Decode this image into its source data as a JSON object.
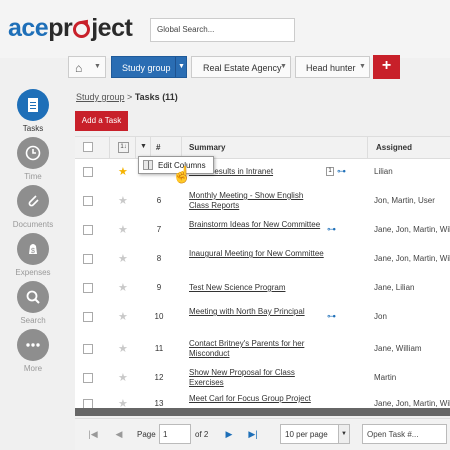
{
  "logo": {
    "part1": "ace",
    "part2": "pr",
    "part3": "ject"
  },
  "search": {
    "placeholder": "Global Search..."
  },
  "toolbar": {
    "home_icon": "home-icon",
    "study_group": "Study group",
    "real_estate": "Real Estate Agency",
    "head_hunter": "Head hunter",
    "add_symbol": "+"
  },
  "sidebar": {
    "items": [
      {
        "label": "Tasks",
        "icon": "tasks-icon",
        "active": true
      },
      {
        "label": "Time",
        "icon": "time-icon"
      },
      {
        "label": "Documents",
        "icon": "documents-icon"
      },
      {
        "label": "Expenses",
        "icon": "expenses-icon"
      },
      {
        "label": "Search",
        "icon": "search-icon"
      },
      {
        "label": "More",
        "icon": "more-icon"
      }
    ]
  },
  "breadcrumb": {
    "project": "Study group",
    "sep": " > ",
    "current": "Tasks",
    "count": "(11)"
  },
  "add_task": "Add a Task",
  "table": {
    "headers": {
      "sort": "1↓",
      "num": "#",
      "summary": "Summary",
      "assigned": "Assigned"
    },
    "rows": [
      {
        "star": true,
        "num": "",
        "summary": "...nal Results in Intranet",
        "assigned": "Lilian",
        "priority": "1",
        "link": true
      },
      {
        "star": false,
        "num": "6",
        "summary": "Monthly Meeting - Show English Class Reports",
        "assigned": "Jon, Martin, User"
      },
      {
        "star": false,
        "num": "7",
        "summary": "Brainstorm Ideas for New Committee",
        "assigned": "Jane, Jon, Martin, Will",
        "link": true
      },
      {
        "star": false,
        "num": "8",
        "summary": "Inaugural Meeting for New Committee",
        "assigned": "Jane, Jon, Martin, Will"
      },
      {
        "star": false,
        "num": "9",
        "summary": "Test New Science Program",
        "assigned": "Jane, Lilian"
      },
      {
        "star": false,
        "num": "10",
        "summary": "Meeting with North Bay Principal",
        "assigned": "Jon",
        "link": true
      },
      {
        "star": false,
        "num": "11",
        "summary": "Contact Britney's Parents for her Misconduct",
        "assigned": "Jane, William"
      },
      {
        "star": false,
        "num": "12",
        "summary": "Show New Proposal for Class Exercises",
        "assigned": "Martin"
      },
      {
        "star": false,
        "num": "13",
        "summary": "Meet Carl for Focus Group Project",
        "assigned": "Jane, Jon, Martin, Will"
      }
    ]
  },
  "popup": {
    "label": "Edit Columns"
  },
  "pager": {
    "page_label": "Page",
    "page_value": "1",
    "of_label": "of 2",
    "per_page": "10 per page",
    "open_task_placeholder": "Open Task #..."
  },
  "colors": {
    "brand_blue": "#1e6fb8",
    "brand_red": "#c8202a",
    "star": "#f5b301"
  }
}
